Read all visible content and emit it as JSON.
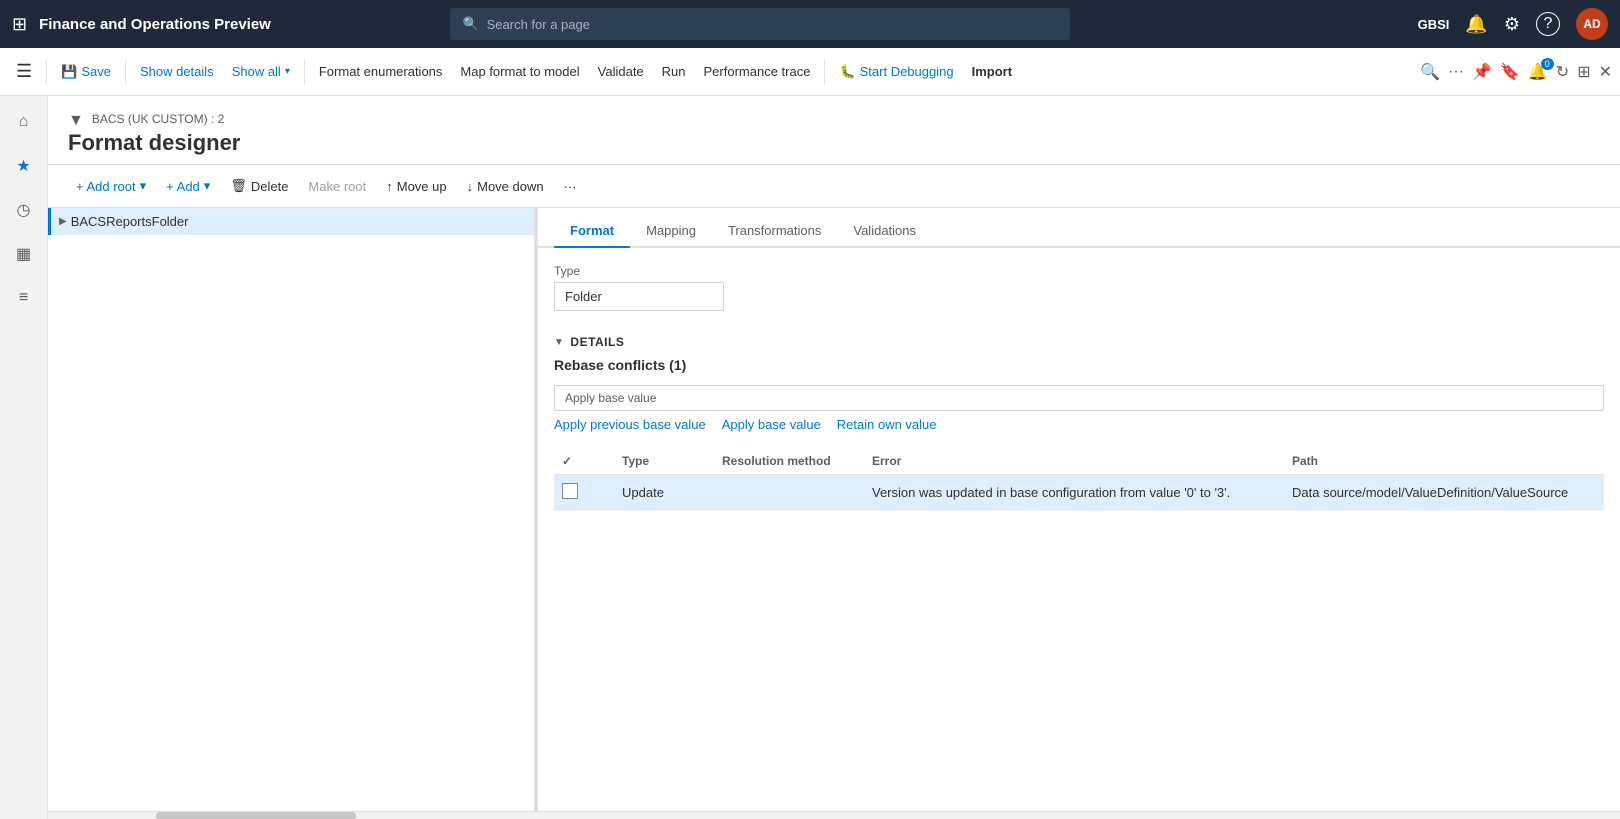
{
  "app": {
    "title": "Finance and Operations Preview",
    "search_placeholder": "Search for a page",
    "user_org": "GBSI",
    "user_initials": "AD"
  },
  "toolbar": {
    "save": "Save",
    "show_details": "Show details",
    "show_all": "Show all",
    "format_enumerations": "Format enumerations",
    "map_format": "Map format to model",
    "validate": "Validate",
    "run": "Run",
    "performance_trace": "Performance trace",
    "start_debugging": "Start Debugging",
    "import": "Import"
  },
  "page": {
    "breadcrumb": "BACS (UK CUSTOM) : 2",
    "title": "Format designer"
  },
  "action_bar": {
    "add_root": "+ Add root",
    "add": "+ Add",
    "delete": "Delete",
    "make_root": "Make root",
    "move_up": "Move up",
    "move_down": "Move down"
  },
  "tabs": {
    "format": "Format",
    "mapping": "Mapping",
    "transformations": "Transformations",
    "validations": "Validations"
  },
  "tree": {
    "item": "BACSReportsFolder"
  },
  "format_details": {
    "type_label": "Type",
    "type_value": "Folder"
  },
  "details_section": {
    "header": "DETAILS",
    "rebase_title": "Rebase conflicts (1)",
    "apply_previous_base": "Apply previous base value",
    "apply_base": "Apply base value",
    "retain_own": "Retain own value"
  },
  "table": {
    "columns": [
      "Resolved",
      "Type",
      "Resolution method",
      "Error",
      "Path"
    ],
    "rows": [
      {
        "resolved": false,
        "type": "Update",
        "resolution_method": "",
        "error": "Version was updated in base configuration from value '0' to '3'.",
        "path": "Data source/model/ValueDefinition/ValueSource"
      }
    ]
  },
  "icons": {
    "grid": "⊞",
    "home": "⌂",
    "star": "★",
    "clock": "◷",
    "table": "▦",
    "list": "≡",
    "search": "🔍",
    "settings": "⚙",
    "help": "?",
    "bell": "🔔",
    "refresh": "↻",
    "expand": "⊞",
    "close": "✕",
    "filter": "▼",
    "chevron_right": "▶",
    "chevron_down": "▼",
    "chevron_down_small": "▾",
    "arrow_up": "↑",
    "arrow_down": "↓",
    "minus": "−",
    "plus": "+",
    "trash": "🗑",
    "debug": "🐛",
    "bookmark": "🔖",
    "more": "···",
    "pin": "📌",
    "star_outline": "☆",
    "check": "✓"
  }
}
